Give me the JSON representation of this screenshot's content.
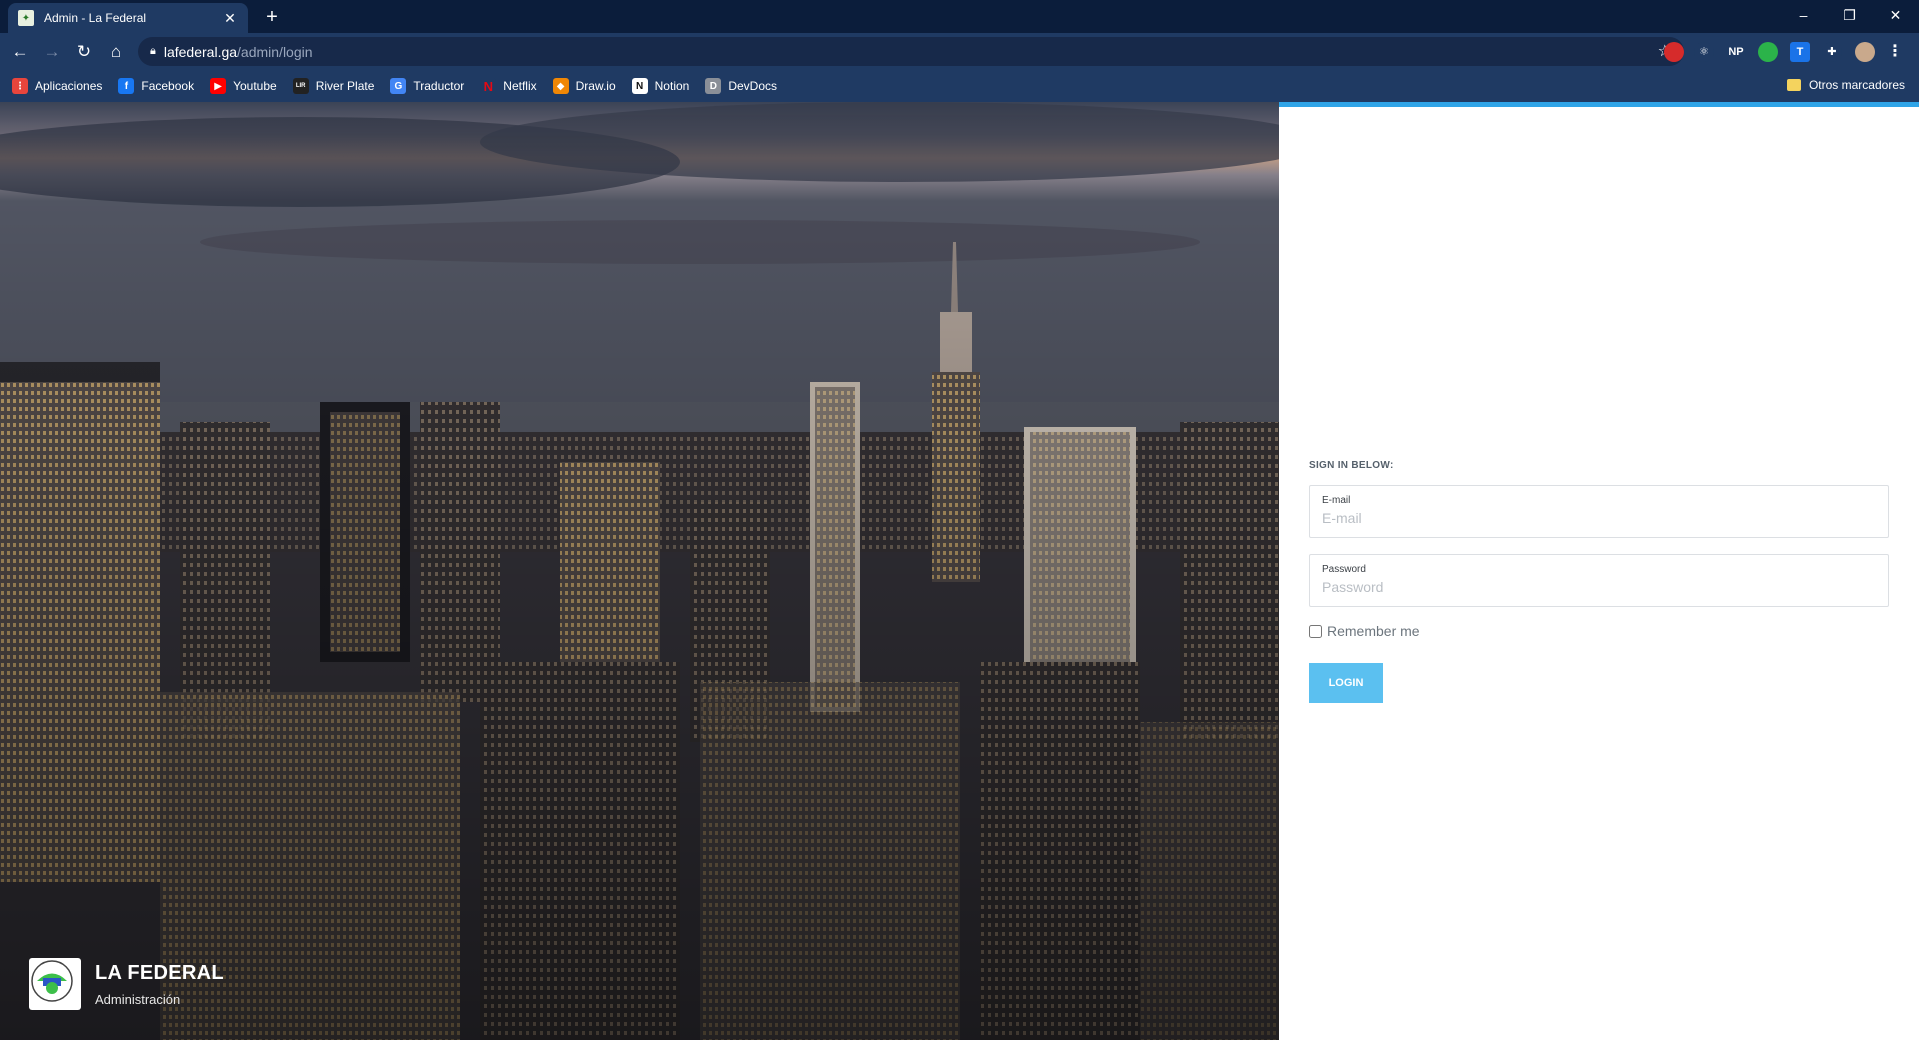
{
  "browser": {
    "tab_title": "Admin - La Federal",
    "url_host": "lafederal.ga",
    "url_path": "/admin/login",
    "extensions": [
      {
        "name": "adblock-icon",
        "label": "",
        "color": "#d62b2b"
      },
      {
        "name": "react-devtools-icon",
        "label": "⚛",
        "color": "#1f3a63"
      },
      {
        "name": "np-extension-icon",
        "label": "NP",
        "color": "#1f3a63"
      },
      {
        "name": "green-extension-icon",
        "label": "",
        "color": "#2bb34a"
      },
      {
        "name": "translate-extension-icon",
        "label": "T",
        "color": "#1a73e8"
      },
      {
        "name": "extensions-puzzle-icon",
        "label": "✚",
        "color": "#1f3a63"
      }
    ]
  },
  "bookmarks": [
    {
      "label": "Aplicaciones",
      "icon": "apps-grid-icon",
      "color": "#e8453c",
      "glyph": "⋮"
    },
    {
      "label": "Facebook",
      "icon": "facebook-icon",
      "color": "#1877f2",
      "glyph": "f"
    },
    {
      "label": "Youtube",
      "icon": "youtube-icon",
      "color": "#ff0000",
      "glyph": "▶"
    },
    {
      "label": "River Plate",
      "icon": "river-plate-icon",
      "color": "#222222",
      "glyph": "LIR"
    },
    {
      "label": "Traductor",
      "icon": "translate-icon",
      "color": "#4285f4",
      "glyph": "G"
    },
    {
      "label": "Netflix",
      "icon": "netflix-icon",
      "color": "#1f3a63",
      "glyph": "N"
    },
    {
      "label": "Draw.io",
      "icon": "drawio-icon",
      "color": "#f08705",
      "glyph": "◆"
    },
    {
      "label": "Notion",
      "icon": "notion-icon",
      "color": "#ffffff",
      "glyph": "N"
    },
    {
      "label": "DevDocs",
      "icon": "devdocs-icon",
      "color": "#8a8f98",
      "glyph": "D"
    }
  ],
  "other_bookmarks": "Otros marcadores",
  "brand": {
    "name": "LA FEDERAL",
    "subtitle": "Administración"
  },
  "login": {
    "heading": "SIGN IN BELOW:",
    "email_label": "E-mail",
    "email_placeholder": "E-mail",
    "email_value": "",
    "password_label": "Password",
    "password_placeholder": "Password",
    "password_value": "",
    "remember_label": "Remember me",
    "remember_checked": false,
    "submit_label": "LOGIN",
    "accent_color": "#2fa4e7",
    "button_color": "#5bc0f0"
  }
}
